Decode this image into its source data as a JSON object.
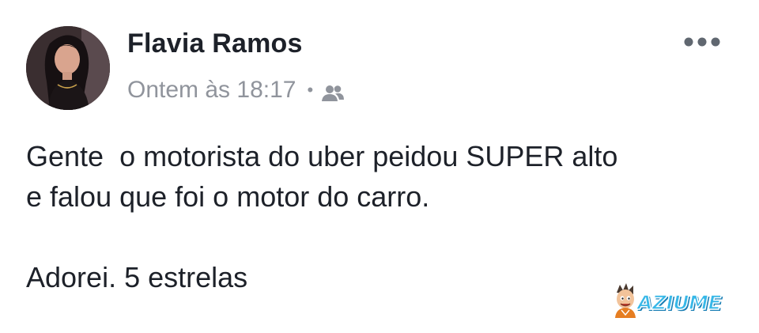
{
  "post": {
    "author": "Flavia Ramos",
    "timestamp": "Ontem às 18:17",
    "separator": "•",
    "audience_icon": "friends-icon",
    "more_icon": "more-dots-icon",
    "body_lines": [
      "Gente  o motorista do uber peidou SUPER alto",
      "e falou que foi o motor do carro.",
      "Adorei. 5 estrelas"
    ]
  },
  "watermark": {
    "text": "AZIUME",
    "color": "#38b8e8"
  },
  "colors": {
    "name": "#1d2129",
    "meta": "#90949c",
    "body": "#1d2129"
  }
}
